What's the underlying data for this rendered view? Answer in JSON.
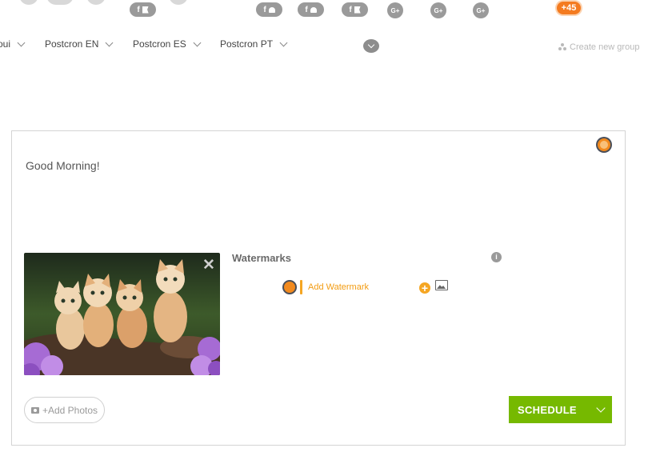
{
  "profiles": [
    {
      "network": "facebook-page",
      "letter": "f"
    },
    {
      "network": "facebook-group",
      "letter": "f"
    },
    {
      "network": "facebook-group",
      "letter": "f"
    },
    {
      "network": "facebook-page",
      "letter": "f"
    },
    {
      "network": "google-plus",
      "letter": "G+"
    },
    {
      "network": "google-plus",
      "letter": "G+"
    },
    {
      "network": "google-plus",
      "letter": "G+"
    }
  ],
  "more_profiles": "+45",
  "groups": {
    "tabs": [
      {
        "label": "oui"
      },
      {
        "label": "Postcron EN"
      },
      {
        "label": "Postcron ES"
      },
      {
        "label": "Postcron PT"
      }
    ],
    "create_label": "Create new group"
  },
  "composer": {
    "text": "Good Morning!",
    "image_alt": "kittens",
    "remove_symbol": "✕"
  },
  "watermarks": {
    "title": "Watermarks",
    "info_symbol": "i",
    "add_label": "Add Watermark",
    "plus_symbol": "+"
  },
  "actions": {
    "add_photos_label": "+Add Photos",
    "schedule_label": "SCHEDULE"
  },
  "colors": {
    "accent": "#f47b20",
    "schedule": "#76b900",
    "watermark": "#f39c12"
  }
}
